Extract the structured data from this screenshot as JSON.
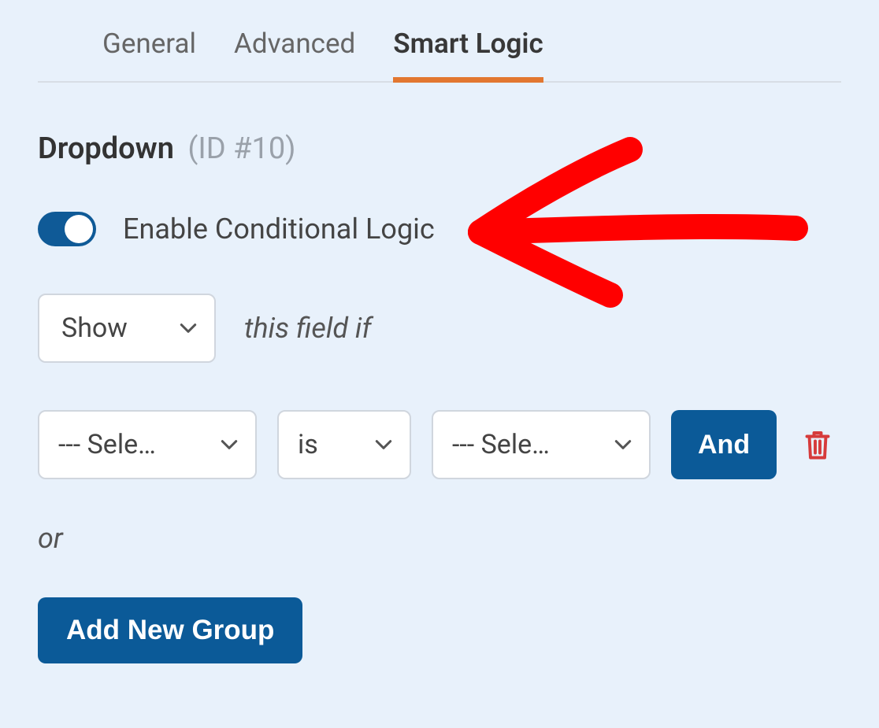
{
  "tabs": {
    "general": "General",
    "advanced": "Advanced",
    "smart_logic": "Smart Logic",
    "active": "smart_logic"
  },
  "field": {
    "name": "Dropdown",
    "id_label": "(ID #10)"
  },
  "toggle": {
    "label": "Enable Conditional Logic",
    "on": true
  },
  "show_row": {
    "action": "Show",
    "suffix": "this field if"
  },
  "rule": {
    "field_value": "--- Sele…",
    "operator": "is",
    "value_value": "--- Sele…",
    "and_label": "And"
  },
  "or_label": "or",
  "add_group_label": "Add New Group",
  "icons": {
    "chevron_down": "chevron-down",
    "trash": "trash",
    "annotation": "hand-drawn-arrow"
  },
  "colors": {
    "accent_blue": "#0b5a98",
    "active_tab_underline": "#e27730",
    "panel_bg": "#e8f1fb",
    "danger": "#d63b3b",
    "annotation_red": "#ff0000"
  }
}
